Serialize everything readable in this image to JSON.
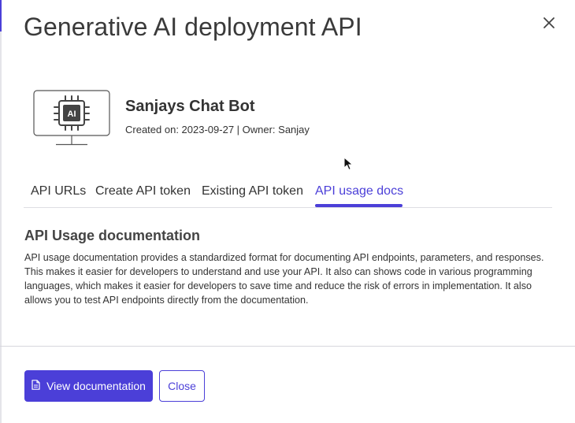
{
  "modal": {
    "title": "Generative AI deployment API"
  },
  "app": {
    "name": "Sanjays Chat Bot",
    "meta": "Created on: 2023-09-27 | Owner: Sanjay",
    "icon_text": "AI"
  },
  "tabs": [
    {
      "label": "API URLs",
      "active": false
    },
    {
      "label": "Create API token",
      "active": false
    },
    {
      "label": "Existing API token",
      "active": false
    },
    {
      "label": "API usage docs",
      "active": true
    }
  ],
  "section": {
    "heading": "API Usage documentation",
    "body": "API usage documentation provides a standardized format for documenting API endpoints, parameters, and responses. This makes it easier for developers to understand and use your API. It also can shows code in various programming languages, which makes it easier for developers to save time and reduce the risk of errors in implementation. It also allows you to test API endpoints directly from the documentation."
  },
  "footer": {
    "primary_label": "View documentation",
    "secondary_label": "Close"
  },
  "colors": {
    "accent": "#4b3fd8",
    "text": "#333333",
    "divider": "#dedee3"
  },
  "icons": {
    "close": "close-icon",
    "app": "monitor-ai-chip-icon",
    "document": "document-icon",
    "cursor": "mouse-pointer-icon"
  }
}
